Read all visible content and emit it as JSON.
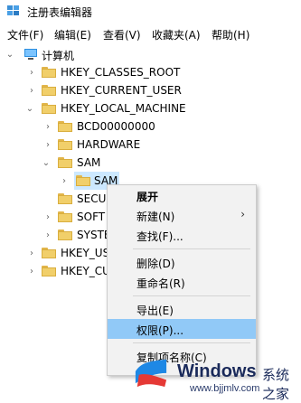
{
  "title": "注册表编辑器",
  "menu": [
    "文件(F)",
    "编辑(E)",
    "查看(V)",
    "收藏夹(A)",
    "帮助(H)"
  ],
  "tree": {
    "computer": "计算机",
    "hkcr": "HKEY_CLASSES_ROOT",
    "hkcu": "HKEY_CURRENT_USER",
    "hklm": "HKEY_LOCAL_MACHINE",
    "bcd": "BCD00000000",
    "hardware": "HARDWARE",
    "sam": "SAM",
    "sam_child": "SAM",
    "secu": "SECU",
    "soft": "SOFT",
    "syste": "SYSTE",
    "hkey_us": "HKEY_US",
    "hkey_cu": "HKEY_CU"
  },
  "context_menu": {
    "expand": "展开",
    "new": "新建(N)",
    "find": "查找(F)...",
    "delete": "删除(D)",
    "rename": "重命名(R)",
    "export": "导出(E)",
    "permissions": "权限(P)...",
    "copy_key_name": "复制项名称(C)"
  },
  "watermark": {
    "brand": "Windows",
    "cn": "系统之家",
    "url": "www.bjjmlv.com"
  },
  "colors": {
    "selection": "#cce8ff",
    "menu_highlight": "#91c9f7",
    "folder": "#f1cf6a"
  }
}
